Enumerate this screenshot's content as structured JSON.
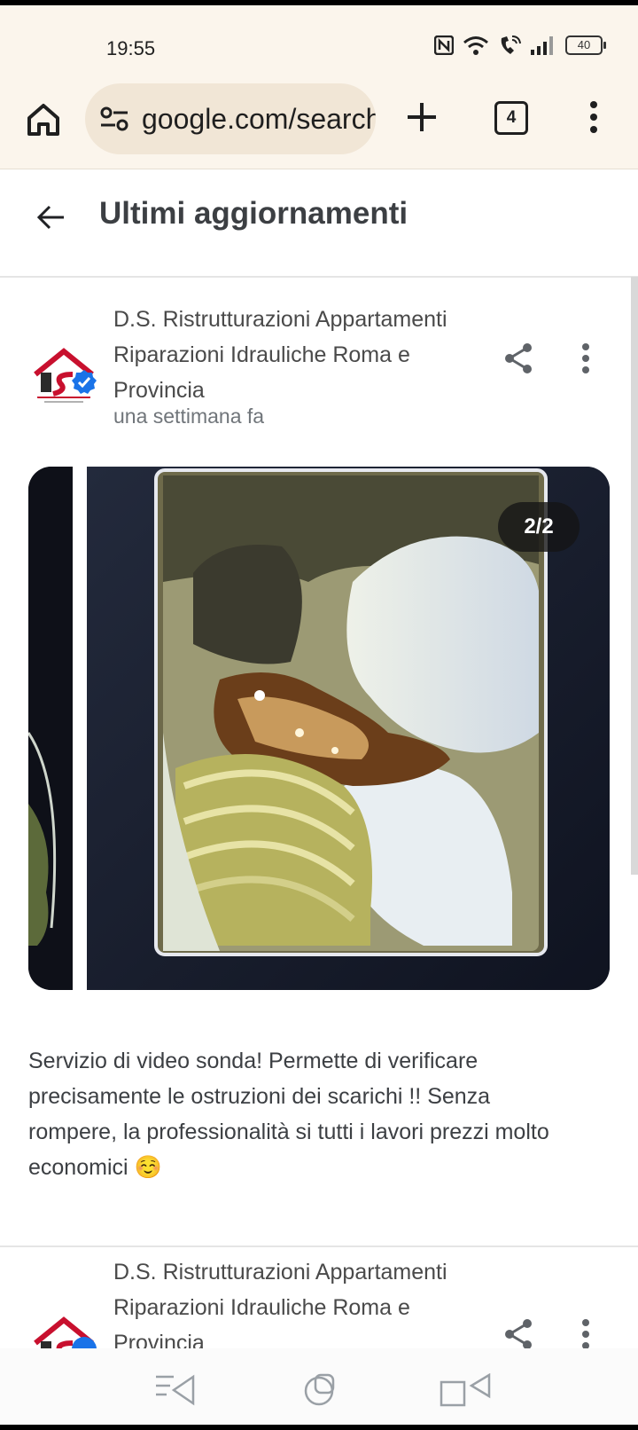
{
  "status_bar": {
    "time": "19:55",
    "battery_level": "40"
  },
  "browser": {
    "url": "google.com/search",
    "tab_count": "4"
  },
  "page": {
    "title": "Ultimi aggiornamenti"
  },
  "post": {
    "business_name": "D.S. Ristrutturazioni Appartamenti Riparazioni Idrauliche Roma e Provincia",
    "time_ago": "una settimana fa",
    "image_counter": "2/2",
    "body": "Servizio di video sonda! Permette di verificare precisamente le ostruzioni dei scarichi !! Senza rompere, la professionalità si tutti i lavori prezzi molto economici ☺️",
    "logo_text": "DS"
  },
  "post2": {
    "business_name": "D.S. Ristrutturazioni Appartamenti Riparazioni Idrauliche Roma e Provincia"
  },
  "colors": {
    "browser_bg": "#fbf5ec",
    "url_pill": "#f1e6d6",
    "verified_blue": "#1a73e8",
    "logo_red": "#c8102e"
  }
}
